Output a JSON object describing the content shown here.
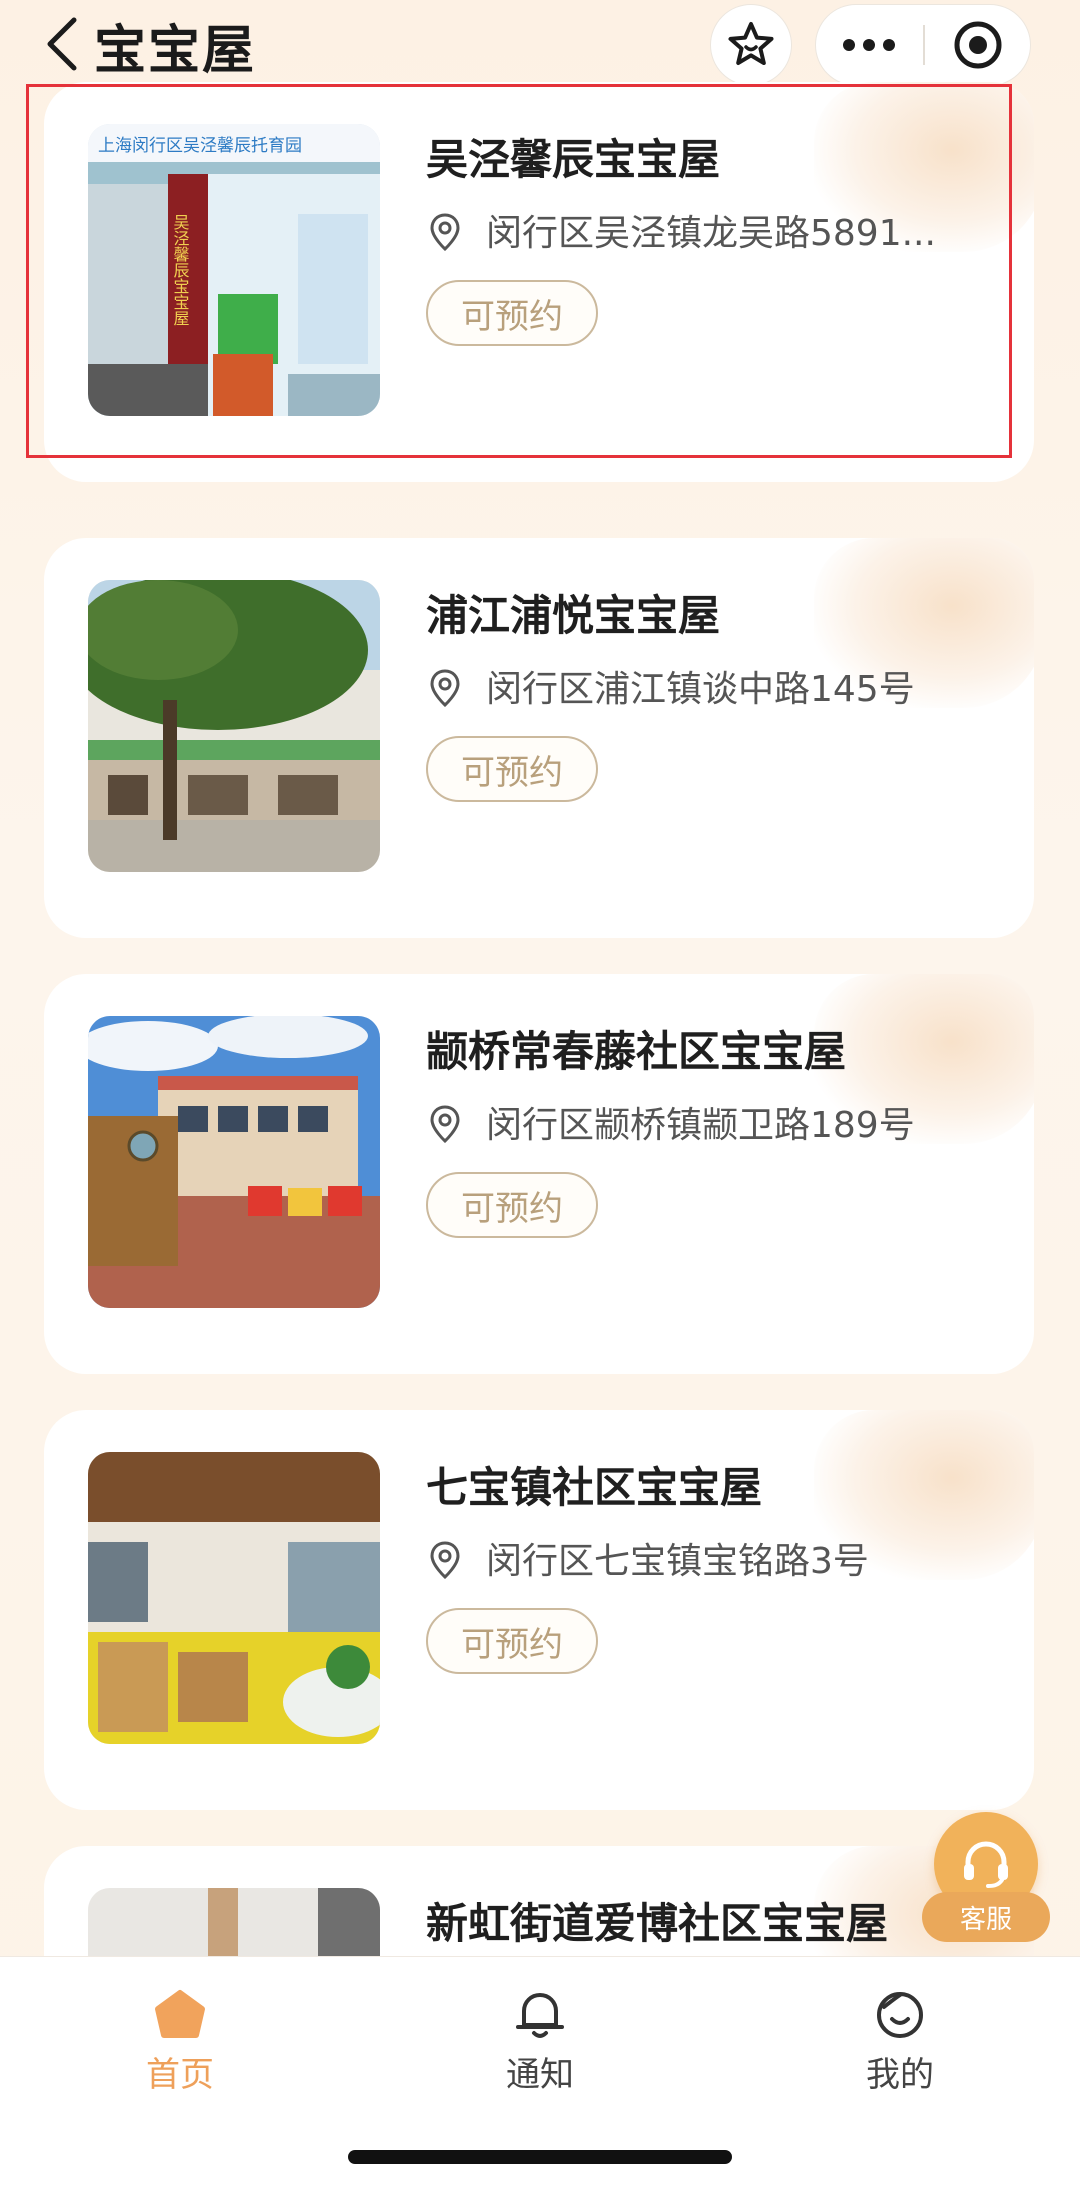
{
  "header": {
    "title": "宝宝屋"
  },
  "cards": [
    {
      "name": "吴泾馨辰宝宝屋",
      "address": "闵行区吴泾镇龙吴路5891...",
      "badge": "可预约",
      "photo_sign": "上海闵行区吴泾馨辰托育园",
      "photo_side_text": "吴泾馨辰宝宝屋"
    },
    {
      "name": "浦江浦悦宝宝屋",
      "address": "闵行区浦江镇谈中路145号",
      "badge": "可预约"
    },
    {
      "name": "颛桥常春藤社区宝宝屋",
      "address": "闵行区颛桥镇颛卫路189号",
      "badge": "可预约"
    },
    {
      "name": "七宝镇社区宝宝屋",
      "address": "闵行区七宝镇宝铭路3号",
      "badge": "可预约"
    },
    {
      "name": "新虹街道爱博社区宝宝屋",
      "address": "",
      "badge": ""
    }
  ],
  "service": {
    "label": "客服"
  },
  "tabs": [
    {
      "label": "首页",
      "icon": "home-icon",
      "active": true
    },
    {
      "label": "通知",
      "icon": "bell-icon",
      "active": false
    },
    {
      "label": "我的",
      "icon": "profile-icon",
      "active": false
    }
  ],
  "colors": {
    "accent": "#eea05a",
    "badge_border": "#cbb99d",
    "highlight": "#e5323a"
  }
}
